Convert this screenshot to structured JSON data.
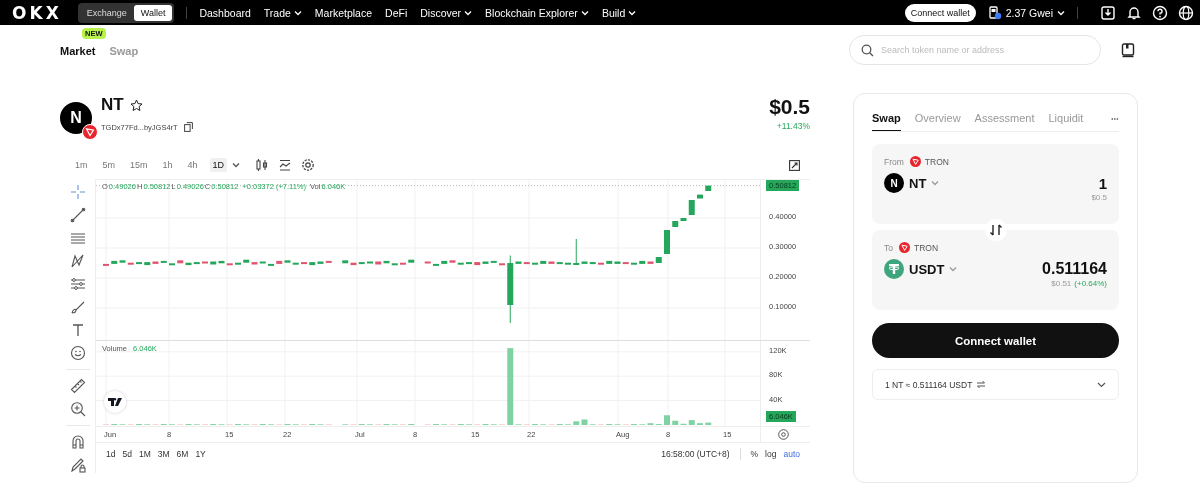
{
  "nav": {
    "logo": "OKX",
    "modes": [
      {
        "label": "Exchange",
        "selected": false
      },
      {
        "label": "Wallet",
        "selected": true
      }
    ],
    "links": [
      {
        "label": "Dashboard",
        "dropdown": false
      },
      {
        "label": "Trade",
        "dropdown": true
      },
      {
        "label": "Marketplace",
        "dropdown": false
      },
      {
        "label": "DeFi",
        "dropdown": false
      },
      {
        "label": "Discover",
        "dropdown": true
      },
      {
        "label": "Blockchain Explorer",
        "dropdown": true
      },
      {
        "label": "Build",
        "dropdown": true
      }
    ],
    "connect_button": "Connect wallet",
    "gas": "2.37 Gwei"
  },
  "subnav": {
    "tabs": [
      {
        "label": "Market",
        "selected": true,
        "badge": "NEW"
      },
      {
        "label": "Swap",
        "selected": false
      }
    ],
    "search": {
      "placeholder": "Search token name or address"
    }
  },
  "token": {
    "symbol": "NT",
    "avatar_letter": "N",
    "address": "TGDx77Fd...byJGS4rT",
    "price": "$0.5",
    "change": "+11.43%"
  },
  "chart": {
    "intervals": [
      {
        "label": "1m",
        "selected": false
      },
      {
        "label": "5m",
        "selected": false
      },
      {
        "label": "15m",
        "selected": false
      },
      {
        "label": "1h",
        "selected": false
      },
      {
        "label": "4h",
        "selected": false
      },
      {
        "label": "1D",
        "selected": true
      }
    ],
    "ohlc": [
      {
        "label": "O",
        "value": "0.49026"
      },
      {
        "label": "H",
        "value": "0.50812"
      },
      {
        "label": "L",
        "value": "0.49026"
      },
      {
        "label": "C",
        "value": "0.50812"
      }
    ],
    "change": "+0.03372 (+7.11%)",
    "vol_label": "Vol",
    "vol_value": "6.046K",
    "last_price": "0.50812",
    "price_ticks": [
      "0.40000",
      "0.30000",
      "0.20000",
      "0.10000"
    ],
    "volume_title": "Volume",
    "volume_value": "6.046K",
    "volume_ticks": [
      "120K",
      "80K",
      "40K"
    ],
    "last_volume": "6.046K",
    "dates": [
      "Jun",
      "8",
      "15",
      "22",
      "Jul",
      "8",
      "15",
      "22",
      "Aug",
      "8",
      "15"
    ],
    "ranges": [
      "1d",
      "5d",
      "1M",
      "3M",
      "6M",
      "1Y"
    ],
    "time": "16:58:00 (UTC+8)",
    "scale_options": [
      {
        "label": "%",
        "selected": false
      },
      {
        "label": "log",
        "selected": false
      },
      {
        "label": "auto",
        "selected": true
      }
    ]
  },
  "swap": {
    "tabs": [
      {
        "label": "Swap",
        "selected": true
      },
      {
        "label": "Overview",
        "selected": false
      },
      {
        "label": "Assessment",
        "selected": false
      },
      {
        "label": "Liquidit",
        "selected": false
      }
    ],
    "from": {
      "label": "From",
      "chain": "TRON",
      "token": "NT",
      "token_letter": "N",
      "amount": "1",
      "value": "$0.5"
    },
    "to": {
      "label": "To",
      "chain": "TRON",
      "token": "USDT",
      "amount": "0.511164",
      "value": "$0.51",
      "change": "(+0.64%)"
    },
    "button": "Connect wallet",
    "rate": "1 NT ≈ 0.511164 USDT"
  }
}
